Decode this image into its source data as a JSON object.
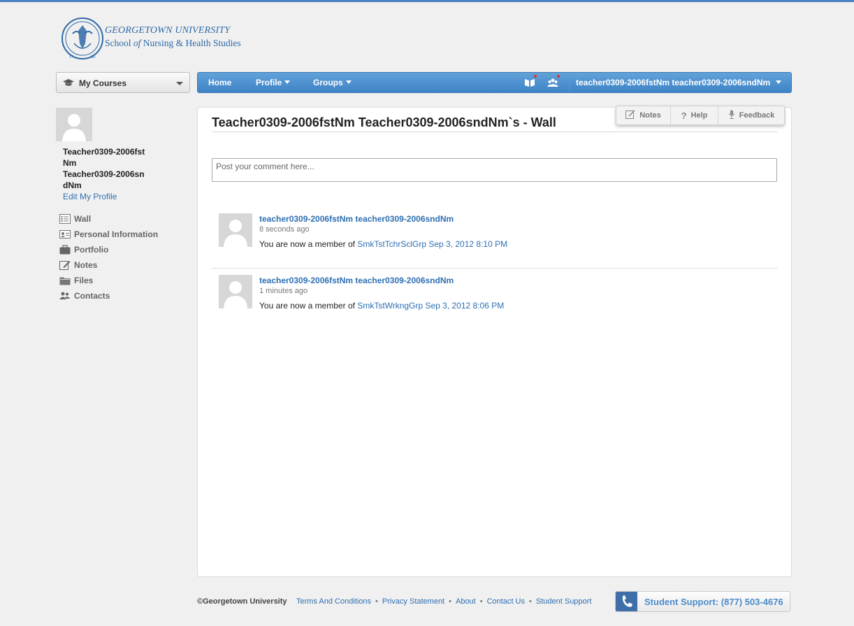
{
  "logo": {
    "line1": "GEORGETOWN UNIVERSITY",
    "line2_a": "School ",
    "line2_of": "of",
    "line2_b": " Nursing & Health Studies",
    "seal_year_left": "17",
    "seal_year_right": "89"
  },
  "courses_dropdown": {
    "label": "My Courses"
  },
  "nav": {
    "home": "Home",
    "profile": "Profile",
    "groups": "Groups",
    "user": "teacher0309-2006fstNm teacher0309-2006sndNm"
  },
  "sidebar": {
    "name_line1": "Teacher0309-2006fst",
    "name_line2": "Nm",
    "name_line3": "Teacher0309-2006sn",
    "name_line4": "dNm",
    "edit_profile": "Edit My Profile",
    "items": [
      {
        "label": "Wall",
        "icon": "wall-icon"
      },
      {
        "label": "Personal Information",
        "icon": "id-card-icon"
      },
      {
        "label": "Portfolio",
        "icon": "briefcase-icon"
      },
      {
        "label": "Notes",
        "icon": "pencil-icon"
      },
      {
        "label": "Files",
        "icon": "folder-icon"
      },
      {
        "label": "Contacts",
        "icon": "contacts-icon"
      }
    ]
  },
  "main": {
    "title": "Teacher0309-2006fstNm Teacher0309-2006sndNm`s - Wall",
    "comment_placeholder": "Post your comment here...",
    "tools": {
      "notes": "Notes",
      "help": "Help",
      "feedback": "Feedback"
    },
    "posts": [
      {
        "author": "teacher0309-2006fstNm teacher0309-2006sndNm",
        "time": "8 seconds ago",
        "message_prefix": "You are now a member of",
        "group": "SmkTstTchrSclGrp",
        "date": "Sep 3, 2012 8:10 PM"
      },
      {
        "author": "teacher0309-2006fstNm teacher0309-2006sndNm",
        "time": "1 minutes ago",
        "message_prefix": "You are now a member of",
        "group": "SmkTstWrkngGrp",
        "date": "Sep 3, 2012 8:06 PM"
      }
    ]
  },
  "footer": {
    "copyright": "©Georgetown University",
    "links": [
      "Terms And Conditions",
      "Privacy Statement",
      "About",
      "Contact Us",
      "Student Support"
    ],
    "support": "Student Support: (877) 503-4676"
  },
  "colors": {
    "accent": "#4a8ccf",
    "link": "#2e6fb2",
    "nav_bar": "#4a8ccf"
  }
}
